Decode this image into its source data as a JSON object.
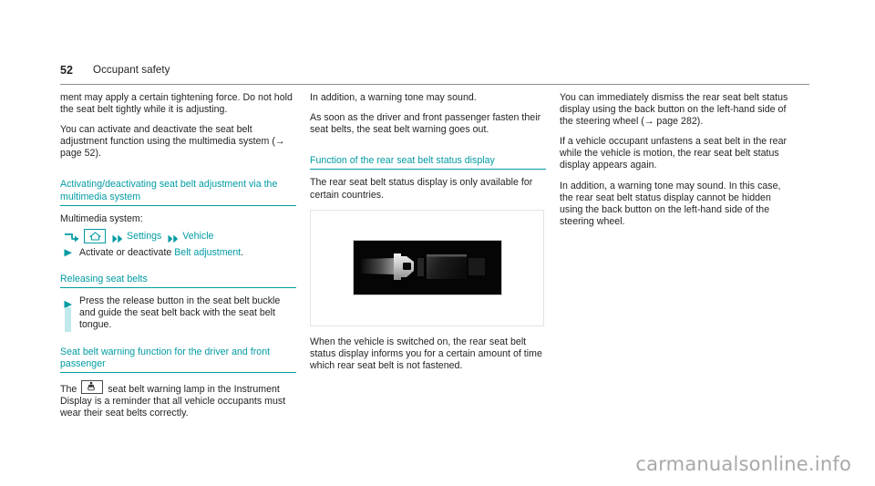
{
  "header": {
    "page_number": "52",
    "section_title": "Occupant safety"
  },
  "columns": {
    "left": {
      "paragraph_1": "ment may apply a certain tightening force. Do not hold the seat belt tightly while it is adjusting.",
      "paragraph_2_part1": "You can activate and deactivate the seat belt adjustment function using the multimedia system (",
      "paragraph_2_ref": "→ page 52",
      "paragraph_2_part2": ").",
      "heading_1": "Activating/deactivating seat belt adjustment via the multimedia system",
      "nav_label": "Multimedia system:",
      "nav_path": {
        "home_icon": "home-icon",
        "step_1": "Settings",
        "step_2": "Vehicle"
      },
      "action_1_prefix": "Activate or deactivate ",
      "action_1_term": "Belt adjustment",
      "action_1_suffix": ".",
      "heading_2": "Releasing seat belts",
      "action_2": "Press the release button in the seat belt buckle and guide the seat belt back with the seat belt tongue.",
      "heading_3": "Seat belt warning function for the driver and front passenger",
      "paragraph_3_part1": "The ",
      "paragraph_3_icon": "seatbelt-warning-lamp-icon",
      "paragraph_3_part2": " seat belt warning lamp in the Instrument Display is a reminder that all vehicle occupants must wear their seat belts correctly."
    },
    "middle": {
      "paragraph_1": "In addition, a warning tone may sound.",
      "paragraph_2": "As soon as the driver and front passenger fasten their seat belts, the seat belt warning goes out.",
      "heading_1": "Function of the rear seat belt status display",
      "paragraph_3": "The rear seat belt status display is only available for certain countries.",
      "figure_caption": "",
      "figure_alt": "seat-belt-buckle-photo",
      "paragraph_4": "When the vehicle is switched on, the rear seat belt status display informs you for a certain amount of time which rear seat belt is not fastened."
    },
    "right": {
      "paragraph_1_part1": "You can immediately dismiss the rear seat belt status display using the back button on the left-hand side of the steering wheel (",
      "paragraph_1_ref": "→ page 282",
      "paragraph_1_part2": ").",
      "paragraph_2": "If a vehicle occupant unfastens a seat belt in the rear while the vehicle is motion, the rear seat belt status display appears again.",
      "paragraph_3": "In addition, a warning tone may sound. In this case, the rear seat belt status display cannot be hidden using the back button on the left-hand side of the steering wheel."
    }
  },
  "watermark": "carmanualsonline.info",
  "colors": {
    "accent_teal": "#009ba3",
    "accent_teal_light": "#bfe9ea",
    "text": "#231f20",
    "rule_gray": "#8d8d8d"
  }
}
